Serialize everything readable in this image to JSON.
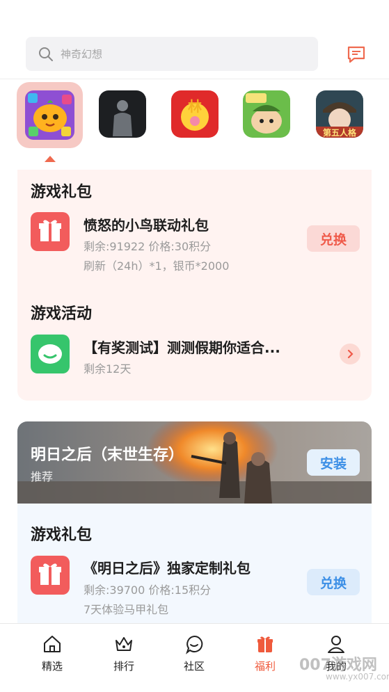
{
  "search": {
    "placeholder": "神奇幻想"
  },
  "games": [
    {
      "name": "pumpkin-puzzle-game-icon",
      "active": true
    },
    {
      "name": "silhouette-game-icon"
    },
    {
      "name": "meng-game-icon"
    },
    {
      "name": "survival-cartoon-game-icon"
    },
    {
      "name": "identity-game-icon"
    }
  ],
  "card1": {
    "gift_section_title": "游戏礼包",
    "gift": {
      "title": "愤怒的小鸟联动礼包",
      "line1": "剩余:91922  价格:30积分",
      "line2": "刷新（24h）*1，银币*2000",
      "button": "兑换"
    },
    "activity_section_title": "游戏活动",
    "activity": {
      "title": "【有奖测试】测测假期你适合...",
      "line1": "剩余12天"
    }
  },
  "card2": {
    "banner_title": "明日之后（末世生存）",
    "banner_sub": "推荐",
    "install_button": "安装",
    "gift_section_title": "游戏礼包",
    "gift": {
      "title": "《明日之后》独家定制礼包",
      "line1": "剩余:39700  价格:15积分",
      "line2": "7天体验马甲礼包",
      "button": "兑换"
    }
  },
  "tabs": [
    {
      "label": "精选"
    },
    {
      "label": "排行"
    },
    {
      "label": "社区"
    },
    {
      "label": "福利",
      "active": true
    },
    {
      "label": "我的"
    }
  ],
  "watermark": {
    "main": "007游戏网",
    "url": "www.yx007.com"
  },
  "colors": {
    "accent": "#ef5a3c",
    "gift_red": "#f25c5c",
    "install_blue": "#3c8fe6"
  }
}
